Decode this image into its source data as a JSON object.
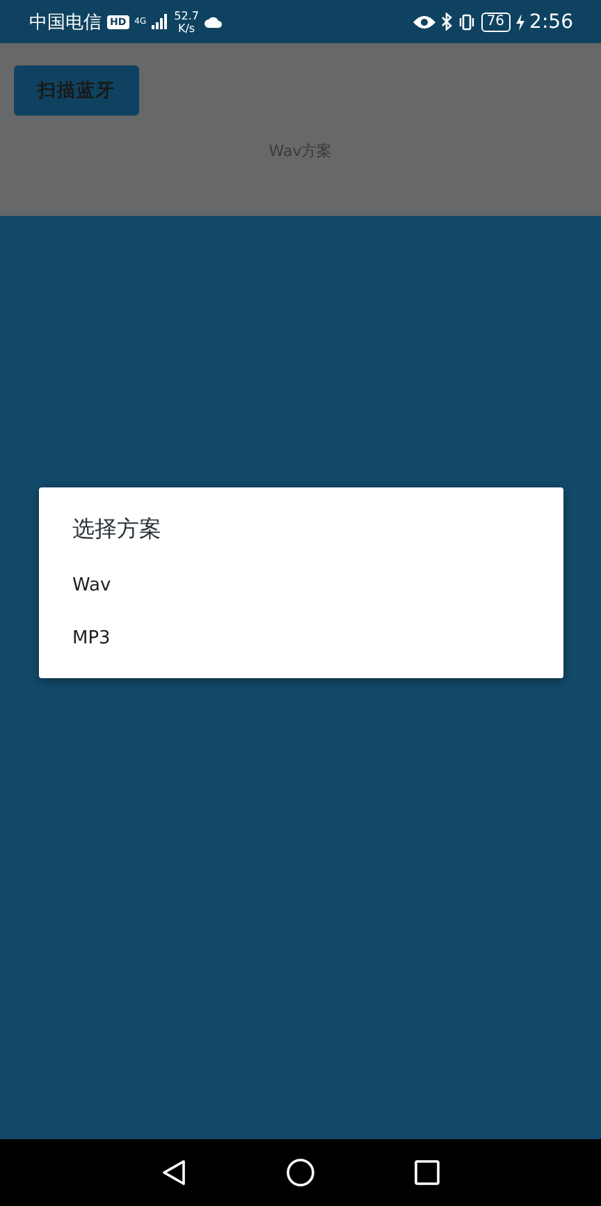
{
  "status_bar": {
    "carrier": "中国电信",
    "hd_badge": "HD",
    "network": "4G",
    "speed": "52.7",
    "speed_unit": "K/s",
    "battery": "76",
    "time": "2:56"
  },
  "app": {
    "scan_button": "扫描蓝牙",
    "scheme_label": "Wav方案"
  },
  "dialog": {
    "title": "选择方案",
    "options": [
      {
        "label": "Wav"
      },
      {
        "label": "MP3"
      }
    ]
  }
}
